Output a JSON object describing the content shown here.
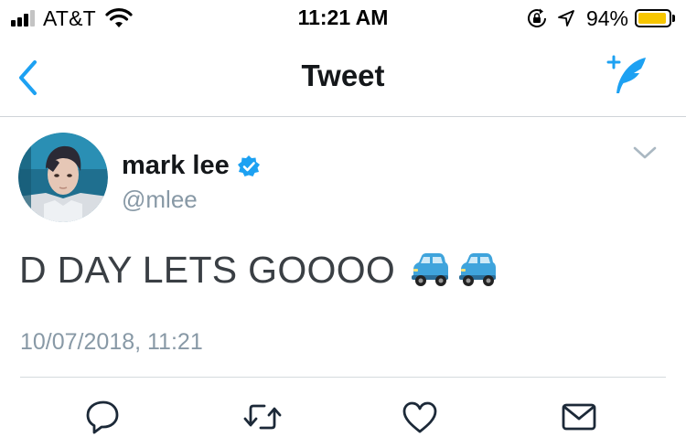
{
  "status_bar": {
    "carrier": "AT&T",
    "time": "11:21 AM",
    "battery_percent_text": "94%",
    "battery_level": 0.94,
    "signal_bars_active": 3,
    "signal_bars_total": 4,
    "icons": [
      "signal-icon",
      "wifi-icon",
      "rotation-lock-icon",
      "location-arrow-icon",
      "battery-icon"
    ]
  },
  "nav": {
    "title": "Tweet",
    "back_icon": "chevron-left-icon",
    "compose_icon": "compose-feather-icon"
  },
  "tweet": {
    "author": {
      "display_name": "mark lee",
      "handle": "@mlee",
      "verified": true,
      "avatar_icon": "avatar-photo"
    },
    "text": "D DAY LETS GOOOO",
    "emojis": [
      "car-emoji",
      "car-emoji"
    ],
    "timestamp": "10/07/2018, 11:21",
    "menu_icon": "chevron-down-icon"
  },
  "actions": [
    "reply-icon",
    "retweet-icon",
    "like-icon",
    "direct-message-icon"
  ],
  "colors": {
    "accent": "#1da1f2",
    "text_primary": "#14171a",
    "text_secondary": "#8899a6",
    "divider": "#cfd4d8",
    "battery": "#f7c600",
    "action_icon": "#1c2938"
  }
}
